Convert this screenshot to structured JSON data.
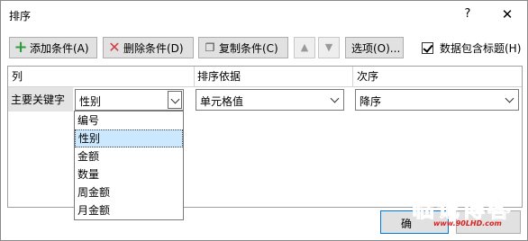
{
  "window": {
    "title": "排序",
    "help": "?",
    "close": "✕"
  },
  "toolbar": {
    "add_label": "添加条件(A)",
    "delete_label": "删除条件(D)",
    "copy_label": "复制条件(C)",
    "up_arrow": "▲",
    "down_arrow": "▼",
    "options_label": "选项(O)...",
    "header_checkbox_label": "数据包含标题(H)",
    "header_checkbox_checked": true
  },
  "grid": {
    "headers": {
      "column": "列",
      "sort_on": "排序依据",
      "order": "次序"
    },
    "row": {
      "label": "主要关键字",
      "column_value": "性别",
      "sort_on_value": "单元格值",
      "order_value": "降序"
    }
  },
  "dropdown": {
    "options": [
      "编号",
      "性别",
      "金额",
      "数量",
      "周金额",
      "月金额"
    ],
    "selected": "性别"
  },
  "footer": {
    "ok_label": "确"
  },
  "watermark": {
    "main": "临记博客",
    "url": "www.90LHD.com"
  }
}
